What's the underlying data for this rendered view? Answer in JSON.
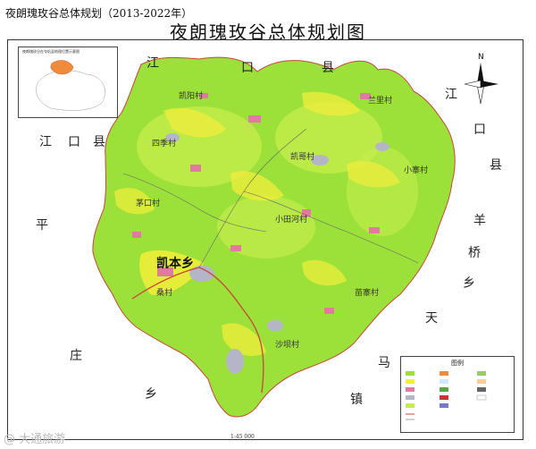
{
  "header": {
    "title": "夜朗瑰玫谷总体规划（2013-2022年）"
  },
  "map": {
    "title": "夜朗瑰玫谷总体规划图",
    "neighbors": [
      "江",
      "口",
      "县",
      "江",
      "口",
      "县",
      "江",
      "口",
      "县",
      "平",
      "庄",
      "乡",
      "羊",
      "桥",
      "乡",
      "天",
      "马",
      "镇"
    ],
    "towns": [
      "凯本乡"
    ],
    "places": [
      "凯阳村",
      "四季村",
      "凯哥村",
      "茅口村",
      "小田河村",
      "兰里村",
      "小寨村",
      "桑村",
      "苗寨村",
      "沙坝村"
    ],
    "colors": {
      "land": "#9ce03a",
      "land_light": "#c4ec4b",
      "yellow": "#f2ee3a",
      "pink": "#e07aa0",
      "gray": "#b5b5c8",
      "border_red": "#c8463a"
    }
  },
  "inset": {
    "title": "夜朗瑰玫谷在岑巩县地理位置示意图"
  },
  "legend": {
    "title": "图例"
  },
  "scale": {
    "label": "1:45 000"
  },
  "watermark": {
    "text": "@ 大通旅游"
  },
  "north": {
    "label": "N"
  }
}
